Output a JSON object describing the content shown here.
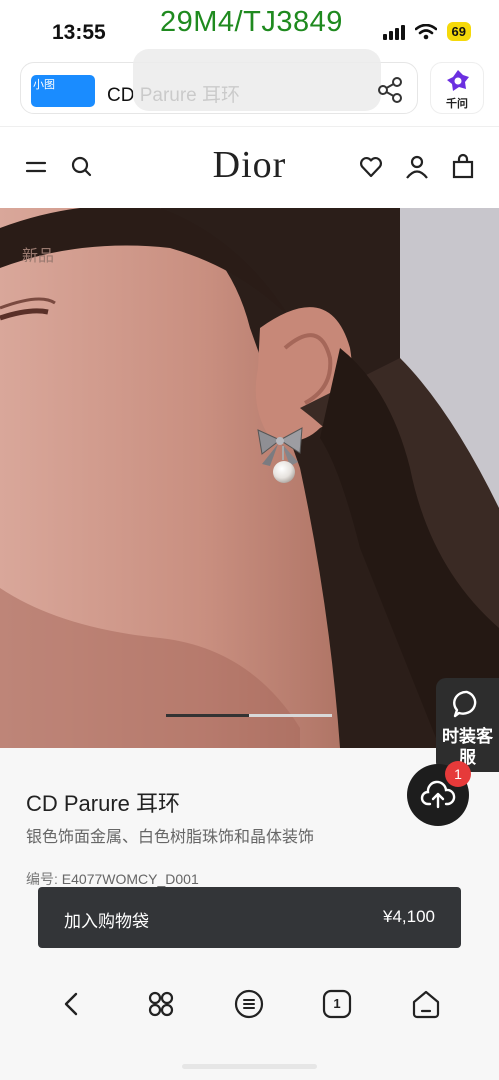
{
  "status_bar": {
    "time": "13:55",
    "battery": "69"
  },
  "watermark": "29M4/TJ3849",
  "browser": {
    "thumbnail_label": "小图",
    "search_text": "CD Parure 耳环",
    "right_app_label": "千问"
  },
  "site": {
    "logo": "Dior"
  },
  "hero": {
    "tag": "新品",
    "slide_progress": 0.5
  },
  "product": {
    "name": "CD Parure 耳环",
    "description": "银色饰面金属、白色树脂珠饰和晶体装饰",
    "sku_label": "编号: ",
    "sku": "E4077WOMCY_D001"
  },
  "floating": {
    "chat_label": "时装客服",
    "upload_badge": "1"
  },
  "cart": {
    "label": "加入购物袋",
    "price": "¥4,100"
  },
  "navbar": {
    "tab_count": "1"
  },
  "colors": {
    "accent_blue": "#1a8cff",
    "watermark_green": "#1f8a1f",
    "badge_red": "#e63a3a",
    "cart_bar": "#333538"
  },
  "icons": [
    "menu-icon",
    "search-icon",
    "heart-icon",
    "user-icon",
    "bag-icon",
    "share-icon",
    "chat-icon",
    "upload-cloud-icon",
    "back-icon",
    "apps-icon",
    "menu-circle-icon",
    "tabs-icon",
    "home-icon"
  ]
}
